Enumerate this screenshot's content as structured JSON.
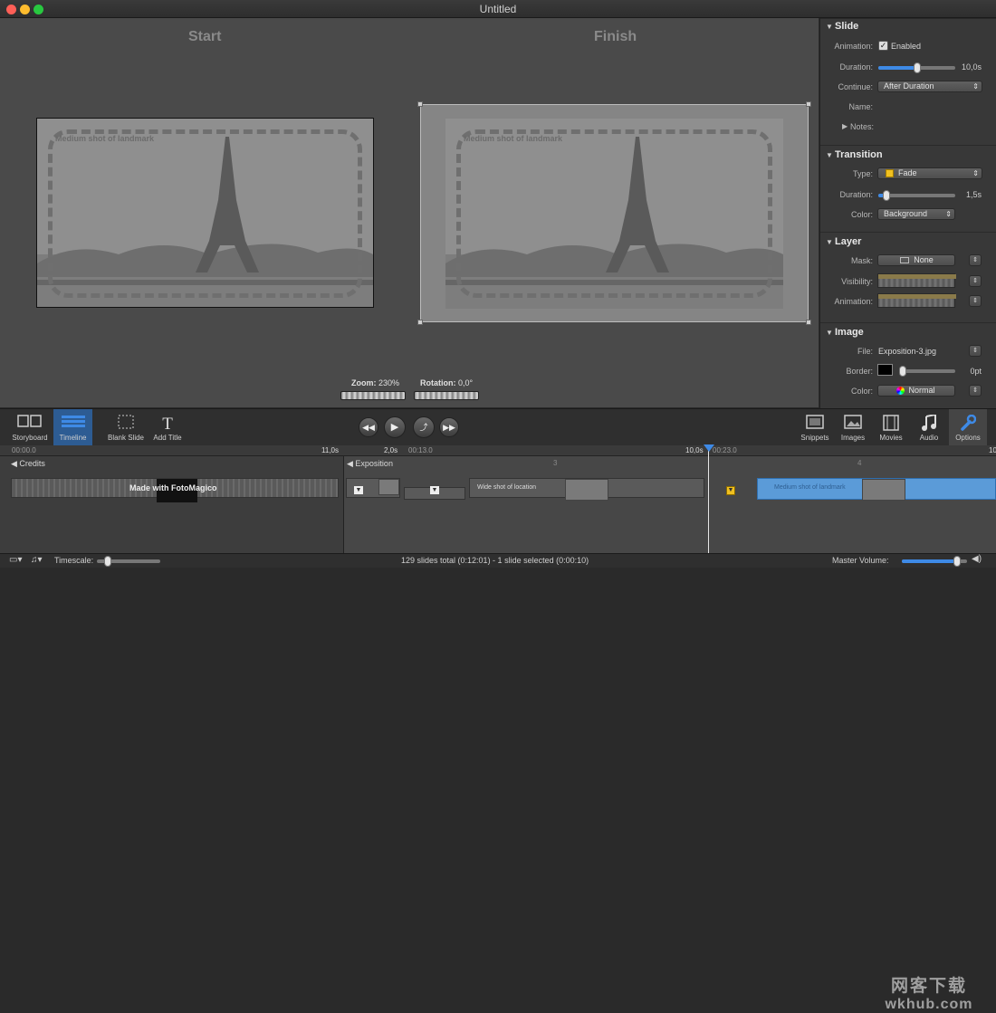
{
  "window": {
    "title": "Untitled"
  },
  "stage": {
    "start_label": "Start",
    "finish_label": "Finish",
    "placeholder_text": "Medium shot of landmark",
    "zoom_label": "Zoom:",
    "zoom_value": "230%",
    "rotation_label": "Rotation:",
    "rotation_value": "0,0°"
  },
  "inspector": {
    "slide": {
      "title": "Slide",
      "animation_label": "Animation:",
      "enabled_label": "Enabled",
      "enabled": true,
      "duration_label": "Duration:",
      "duration_value": "10,0s",
      "duration_fraction": 0.5,
      "continue_label": "Continue:",
      "continue_value": "After Duration",
      "name_label": "Name:",
      "notes_label": "Notes:"
    },
    "transition": {
      "title": "Transition",
      "type_label": "Type:",
      "type_value": "Fade",
      "duration_label": "Duration:",
      "duration_value": "1,5s",
      "duration_fraction": 0.1,
      "color_label": "Color:",
      "color_value": "Background"
    },
    "layer": {
      "title": "Layer",
      "mask_label": "Mask:",
      "mask_value": "None",
      "visibility_label": "Visibility:",
      "animation_label": "Animation:"
    },
    "image": {
      "title": "Image",
      "file_label": "File:",
      "file_value": "Exposition-3.jpg",
      "border_label": "Border:",
      "border_value": "0pt",
      "border_fraction": 0.05,
      "color_label": "Color:",
      "color_value": "Normal"
    }
  },
  "toolbar": {
    "storyboard": "Storyboard",
    "timeline": "Timeline",
    "blank_slide": "Blank Slide",
    "add_title": "Add Title",
    "snippets": "Snippets",
    "images": "Images",
    "movies": "Movies",
    "audio": "Audio",
    "options": "Options"
  },
  "ruler": {
    "t0": "00:00.0",
    "t1": "11,0s",
    "t2": "2,0s",
    "t3": "00:13.0",
    "t4": "10,0s",
    "t5": "00:23.0",
    "t6": "10"
  },
  "tracks": {
    "credits": "Credits",
    "exposition": "Exposition",
    "made_with": "Made with FotoMagico",
    "wide_shot": "Wide shot of location",
    "medium_shot": "Medium shot of landmark",
    "num3": "3",
    "num4": "4"
  },
  "status": {
    "timescale_label": "Timescale:",
    "summary": "129 slides total (0:12:01)  -  1 slide selected (0:00:10)",
    "master_volume_label": "Master Volume:",
    "master_volume_fraction": 0.85
  },
  "watermark": {
    "line1": "网客下载",
    "line2": "wkhub.com"
  },
  "colors": {
    "accent": "#3e8ae6",
    "selected_clip": "#5b9bd8"
  }
}
